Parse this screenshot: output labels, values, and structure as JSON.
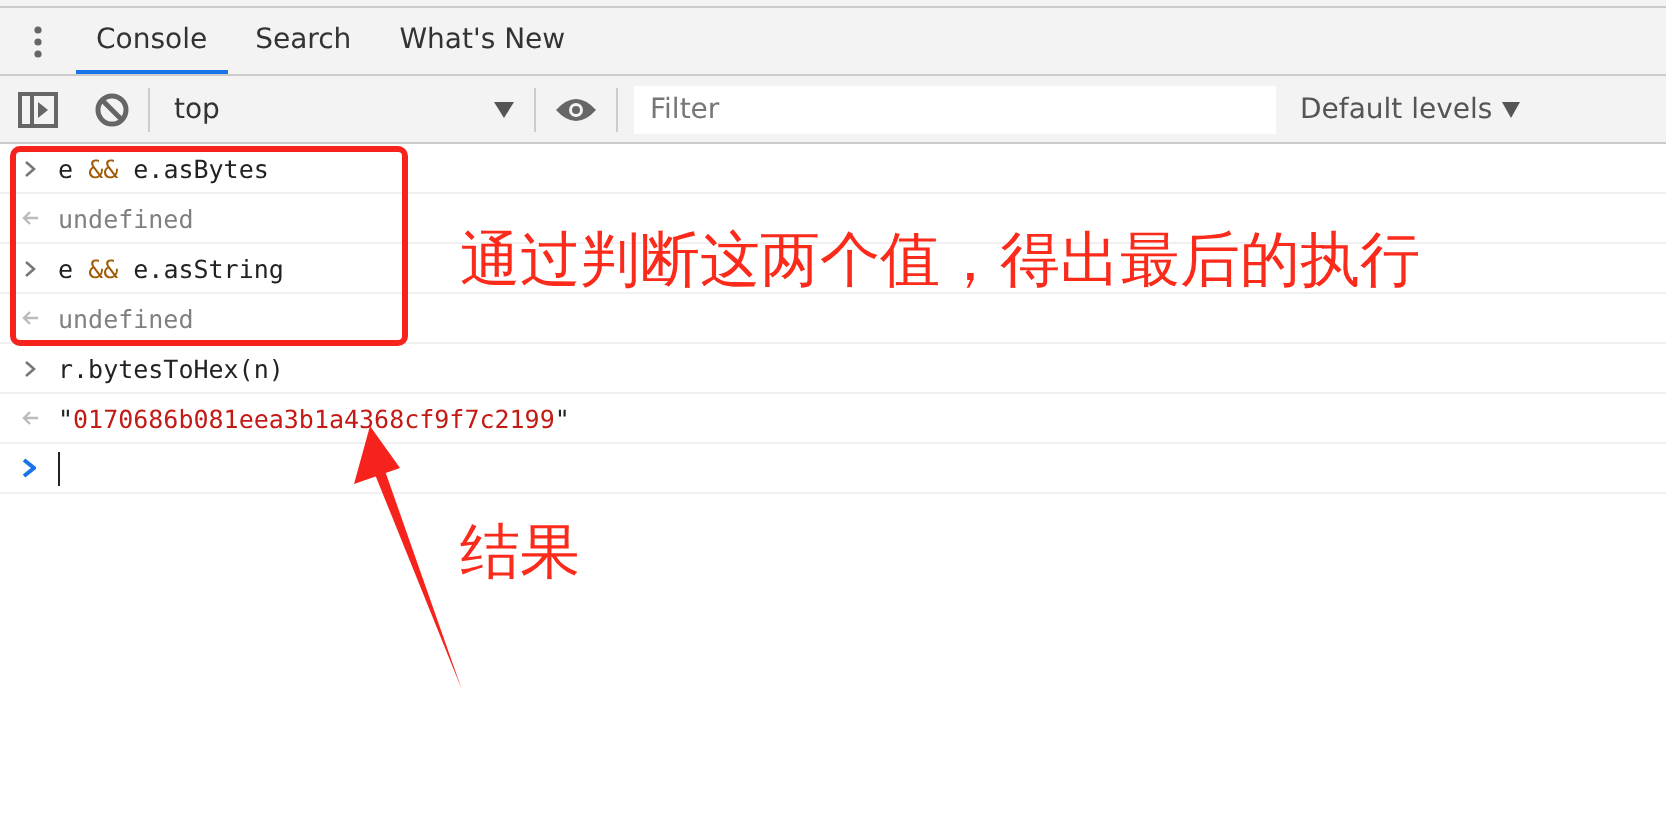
{
  "tabs": [
    {
      "label": "Console",
      "selected": true
    },
    {
      "label": "Search",
      "selected": false
    },
    {
      "label": "What's New",
      "selected": false
    }
  ],
  "toolbar": {
    "context": "top",
    "filter": {
      "placeholder": "Filter"
    },
    "levels": "Default levels"
  },
  "console": [
    {
      "kind": "input",
      "segments": [
        {
          "text": "e ",
          "kind": "plain"
        },
        {
          "text": "&&",
          "kind": "operator"
        },
        {
          "text": " e.asBytes",
          "kind": "plain"
        }
      ]
    },
    {
      "kind": "result",
      "segments": [
        {
          "text": "undefined",
          "kind": "undefined"
        }
      ]
    },
    {
      "kind": "input",
      "segments": [
        {
          "text": "e ",
          "kind": "plain"
        },
        {
          "text": "&&",
          "kind": "operator"
        },
        {
          "text": " e.asString",
          "kind": "plain"
        }
      ]
    },
    {
      "kind": "result",
      "segments": [
        {
          "text": "undefined",
          "kind": "undefined"
        }
      ]
    },
    {
      "kind": "input",
      "segments": [
        {
          "text": "r.bytesToHex(n)",
          "kind": "plain"
        }
      ]
    },
    {
      "kind": "result",
      "segments": [
        {
          "text": "\"",
          "kind": "plain"
        },
        {
          "text": "0170686b081eea3b1a4368cf9f7c2199",
          "kind": "string"
        },
        {
          "text": "\"",
          "kind": "plain"
        }
      ]
    },
    {
      "kind": "prompt"
    }
  ],
  "annotations": {
    "note": "通过判断这两个值，得出最后的执行",
    "result_note": "结果"
  }
}
